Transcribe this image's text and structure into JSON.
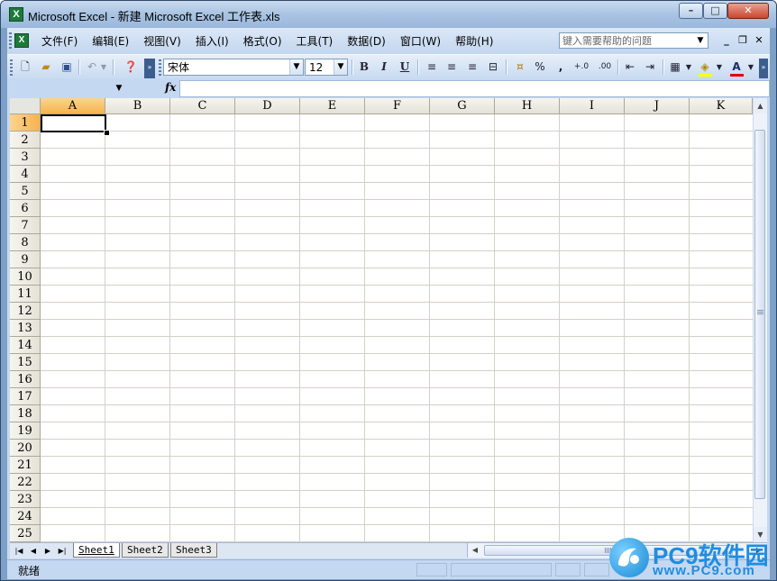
{
  "window": {
    "title": "Microsoft Excel - 新建 Microsoft Excel 工作表.xls",
    "app_icon_label": "X",
    "buttons": {
      "minimize": "–",
      "maximize": "□",
      "close": "✕"
    }
  },
  "menubar": {
    "items": [
      "文件(F)",
      "编辑(E)",
      "视图(V)",
      "插入(I)",
      "格式(O)",
      "工具(T)",
      "数据(D)",
      "窗口(W)",
      "帮助(H)"
    ],
    "help_placeholder": "键入需要帮助的问题",
    "doc_buttons": {
      "minimize": "_",
      "restore": "❐",
      "close": "✕"
    }
  },
  "toolbar": {
    "font_name": "宋体",
    "font_size": "12",
    "bold": "B",
    "italic": "I",
    "underline": "U",
    "percent": "%",
    "comma": ",",
    "increase_decimal": "+.0",
    "decrease_decimal": ".00",
    "font_color_label": "A"
  },
  "formula_bar": {
    "name_box_value": "",
    "fx_label": "fx",
    "formula_value": ""
  },
  "grid": {
    "columns": [
      "A",
      "B",
      "C",
      "D",
      "E",
      "F",
      "G",
      "H",
      "I",
      "J",
      "K"
    ],
    "rows": [
      "1",
      "2",
      "3",
      "4",
      "5",
      "6",
      "7",
      "8",
      "9",
      "10",
      "11",
      "12",
      "13",
      "14",
      "15",
      "16",
      "17",
      "18",
      "19",
      "20",
      "21",
      "22",
      "23",
      "24",
      "25"
    ],
    "active_cell": "A1"
  },
  "sheets": {
    "tabs": [
      "Sheet1",
      "Sheet2",
      "Sheet3"
    ],
    "active": "Sheet1"
  },
  "status": {
    "text": "就绪"
  },
  "watermark": {
    "brand": "PC9软件园",
    "url": "www.PC9.com"
  },
  "colors": {
    "title_gradient_top": "#c9daee",
    "chrome": "#c5d8f1",
    "active_header": "#f6b34e",
    "grid_line": "#d4d0c8",
    "excel_green": "#1d7a3a",
    "watermark_blue": "#1f8de0"
  }
}
